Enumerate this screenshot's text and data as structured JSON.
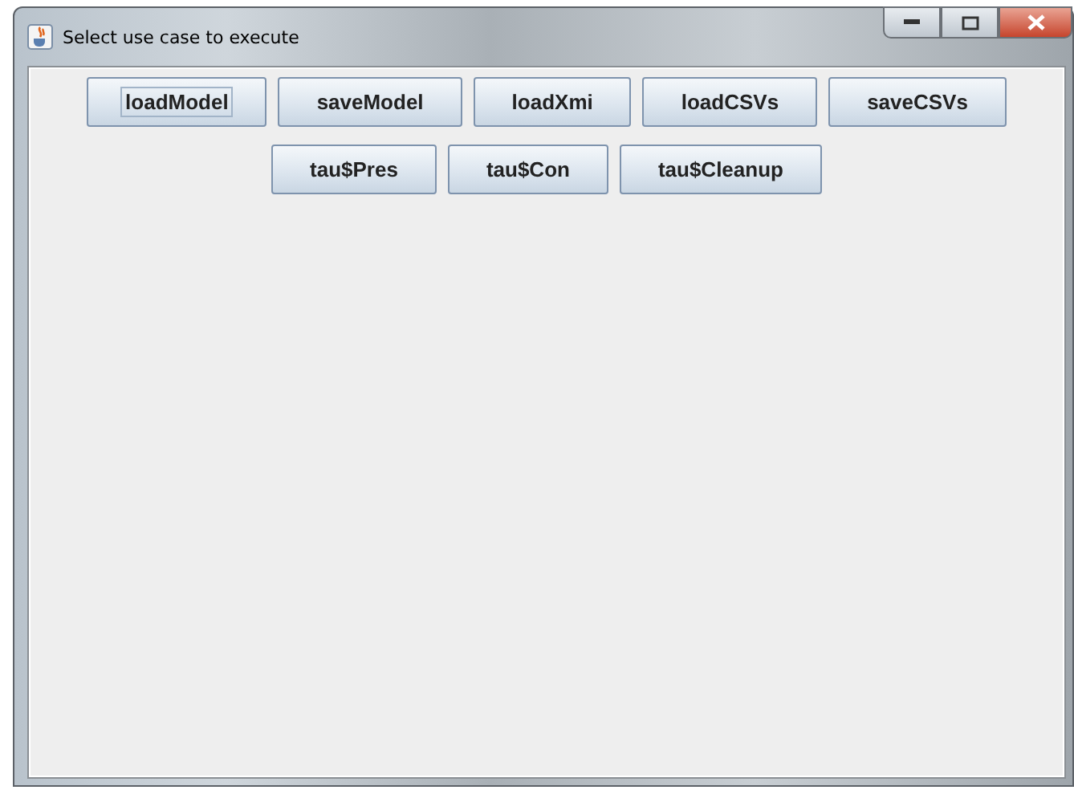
{
  "window": {
    "title": "Select use case to execute"
  },
  "button_rows": [
    [
      {
        "label": "loadModel",
        "focused": true
      },
      {
        "label": "saveModel",
        "focused": false
      },
      {
        "label": "loadXmi",
        "focused": false
      },
      {
        "label": "loadCSVs",
        "focused": false
      },
      {
        "label": "saveCSVs",
        "focused": false
      }
    ],
    [
      {
        "label": "tau$Pres",
        "focused": false
      },
      {
        "label": "tau$Con",
        "focused": false
      },
      {
        "label": "tau$Cleanup",
        "focused": false
      }
    ]
  ]
}
